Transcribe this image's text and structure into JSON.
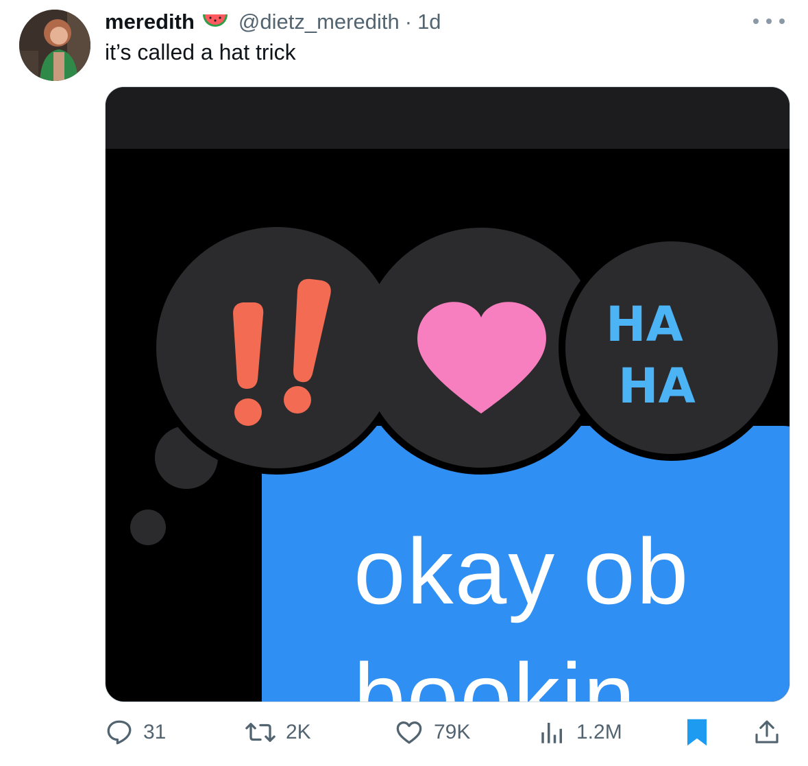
{
  "tweet": {
    "name": "meredith",
    "name_emoji": "watermelon-emoji",
    "handle": "@dietz_meredith",
    "separator": "·",
    "time": "1d",
    "text": "it’s called a hat trick"
  },
  "media": {
    "reactions": [
      "exclamation-reaction",
      "heart-reaction",
      "haha-reaction"
    ],
    "haha_line1": "HA",
    "haha_line2": "HA",
    "bubble_line1": "okay ob",
    "bubble_line2": "bookin",
    "colors": {
      "bubble_blue": "#2f8ff3",
      "reaction_bg": "#2b2b2d",
      "heart_pink": "#f77fbf",
      "exclaim_red": "#f26b52",
      "haha_blue": "#4cb3f5"
    }
  },
  "actions": {
    "replies": "31",
    "reposts": "2K",
    "likes": "79K",
    "views": "1.2M",
    "bookmark_active_color": "#1d9bf0"
  }
}
